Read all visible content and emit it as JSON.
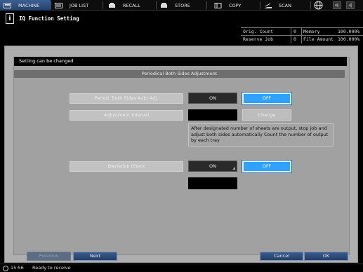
{
  "tabs": [
    {
      "label": "MACHINE",
      "icon": "machine-icon",
      "active": true
    },
    {
      "label": "JOB LIST",
      "icon": "job-list-icon",
      "active": false
    },
    {
      "label": "RECALL",
      "icon": "recall-icon",
      "active": false
    },
    {
      "label": "STORE",
      "icon": "store-icon",
      "active": false
    },
    {
      "label": "COPY",
      "icon": "copy-icon",
      "active": false
    },
    {
      "label": "SCAN",
      "icon": "scan-icon",
      "active": false
    }
  ],
  "header": {
    "title": "IQ Function Setting",
    "info": {
      "orig_count_label": "Orig. Count",
      "orig_count_value": "0",
      "memory_label": "Memory",
      "memory_value": "100.000%",
      "reserve_job_label": "Reserve Job",
      "reserve_job_value": "0",
      "file_amount_label": "File Amount",
      "file_amount_value": "100.000%"
    }
  },
  "banner": "Setting can be changed",
  "section_title": "Periodical Both Sides Adjustment",
  "rows": {
    "auto_adj_label": "Period. Both Sides Auto Adj.",
    "auto_adj_on": "ON",
    "auto_adj_off": "OFF",
    "interval_label": "Adjustment Interval",
    "interval_value": "",
    "change_label": "Change",
    "note": "After designated number of sheets are output, stop job and adjust both sides automatically Count the number of output by each tray",
    "deviation_label": "Deviation Check",
    "deviation_on": "ON",
    "deviation_off": "OFF",
    "deviation_value": ""
  },
  "footer": {
    "previous": "Previous",
    "next": "Next",
    "cancel": "Cancel",
    "ok": "OK"
  },
  "status": {
    "time": "15:56",
    "message": "Ready to receive"
  },
  "colors": {
    "accent": "#2fa2ff",
    "tab_active": "#2e4f80",
    "panel": "#aeaeae"
  }
}
